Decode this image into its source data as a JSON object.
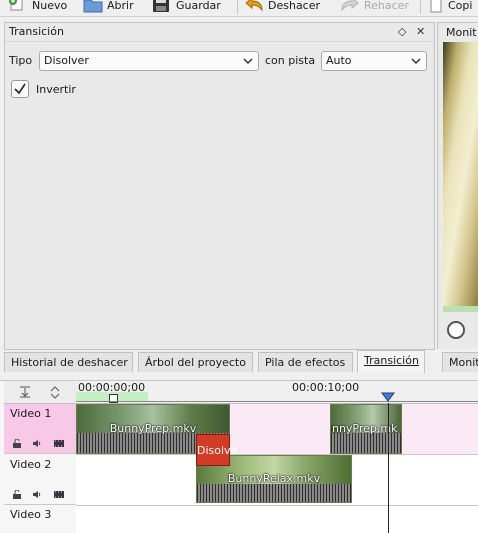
{
  "toolbar": {
    "new_label": "Nuevo",
    "open_label": "Abrir",
    "save_label": "Guardar",
    "undo_label": "Deshacer",
    "redo_label": "Rehacer",
    "copy_label": "Copi"
  },
  "transition_panel": {
    "title": "Transición",
    "type_label": "Tipo",
    "type_value": "Disolver",
    "track_label": "con pista",
    "track_value": "Auto",
    "invert_label": "Invertir",
    "invert_checked": true
  },
  "monitor_panel": {
    "title": "Monit"
  },
  "tabs": [
    {
      "label": "Historial de deshacer"
    },
    {
      "label": "Árbol del proyecto"
    },
    {
      "label": "Pila de efectos"
    },
    {
      "label": "Transición"
    },
    {
      "label": "Monit"
    }
  ],
  "timeline": {
    "ruler_times": [
      "00:00:00;00",
      "00:00:10;00"
    ],
    "tracks": [
      {
        "name": "Video 1",
        "clips": [
          "BunnyPrep.mkv",
          "unnyPrep.mk"
        ]
      },
      {
        "name": "Video 2",
        "clips": [
          "BunnyRelax.mkv"
        ]
      },
      {
        "name": "Video 3",
        "clips": []
      }
    ],
    "transition_label": "Disolve"
  },
  "colors": {
    "selected_track": "#f7c9e6",
    "transition": "#cc3322",
    "playhead": "#4a7ad0"
  }
}
